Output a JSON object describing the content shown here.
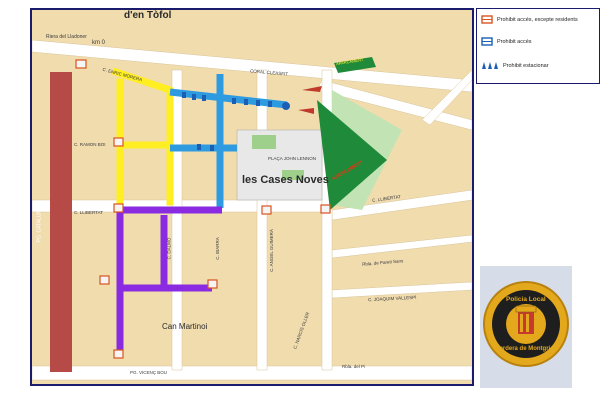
{
  "map": {
    "streets": {
      "tofol": "d'en Tòfol",
      "km": "km 0",
      "lladoner": "Riera del Lladoner",
      "enric_morera": "C. ENRIC MORERA",
      "coral": "CORAL CLEASFIT",
      "ramon_boi": "C. RAMON BOI",
      "lluretat": "C. LLIBERTAT",
      "lluretat_east": "C. LLIBERTAT",
      "catalunya": "PG. CATALUNYA",
      "dalmo": "C. DALMO",
      "ibarra": "C. IBARRA",
      "gomesa": "C. ANGEL GUIMERÀ",
      "pareti_sans": "Rbla. de Pareti Sans",
      "joaquim_vallespi": "C. JOAQUIM VALLESPÍ",
      "narcis": "C. NARCÍS OLLER",
      "vicenc_bou": "PG. VICENÇ BOU",
      "rambla": "Rbla. del Pi",
      "cases_noves": "les Cases Noves",
      "placa": "PLAÇA JOHN LENNON",
      "can_martinoi": "Can Martinoi",
      "aparcament": "APARCAMENT",
      "green_sign": "APARCAMENT"
    }
  },
  "legend": {
    "items": [
      {
        "label": "Prohibit accés, excepte residents",
        "icon": "no-entry-barrier-icon"
      },
      {
        "label": "Prohibit accés",
        "icon": "blue-barrier-icon"
      },
      {
        "label": "Prohibit estacionar",
        "icon": "traffic-cone-icon"
      }
    ]
  },
  "badge": {
    "top_text": "Policia Local",
    "bottom_text": "Tordera de Montgrí"
  },
  "colors": {
    "yellow": "#ffee22",
    "blue": "#2e9be0",
    "purple": "#8a2be2",
    "green": "#1f8a3a",
    "red_block": "#b54a47"
  }
}
